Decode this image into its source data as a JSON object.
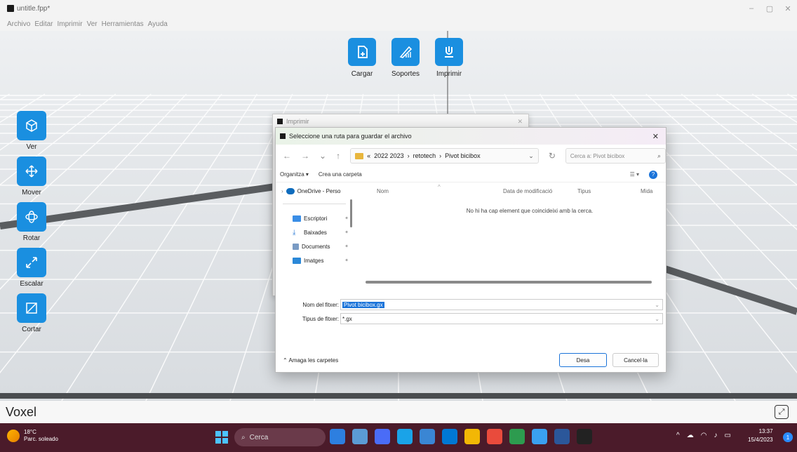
{
  "window": {
    "title": "untitle.fpp*",
    "controls": [
      "–",
      "▢",
      "✕"
    ]
  },
  "menu": [
    "Archivo",
    "Editar",
    "Imprimir",
    "Ver",
    "Herramientas",
    "Ayuda"
  ],
  "top_tools": [
    {
      "label": "Cargar",
      "icon": "load-icon"
    },
    {
      "label": "Soportes",
      "icon": "supports-icon"
    },
    {
      "label": "Imprimir",
      "icon": "print-icon"
    }
  ],
  "side_tools": [
    {
      "label": "Ver",
      "icon": "view-cube-icon"
    },
    {
      "label": "Mover",
      "icon": "move-icon"
    },
    {
      "label": "Rotar",
      "icon": "rotate-icon"
    },
    {
      "label": "Escalar",
      "icon": "scale-icon"
    },
    {
      "label": "Cortar",
      "icon": "cut-icon"
    }
  ],
  "bg_dialog": {
    "title": "Imprimir"
  },
  "save_dialog": {
    "title": "Seleccione una ruta para guardar el archivo",
    "breadcrumb": [
      "2022 2023",
      "retotech",
      "Pivot bicibox"
    ],
    "search_placeholder": "Cerca a: Pivot bicibox",
    "organize": "Organitza ▾",
    "new_folder": "Crea una carpeta",
    "nav": [
      {
        "label": "OneDrive - Perso",
        "color": "#0f6cbd"
      },
      {
        "label": "Escriptori",
        "color": "#3a8ee6"
      },
      {
        "label": "Baixades",
        "color": "#2a7ad5"
      },
      {
        "label": "Documents",
        "color": "#7a9bc4"
      },
      {
        "label": "Imatges",
        "color": "#2b88d8"
      }
    ],
    "columns": [
      "Nom",
      "Data de modificació",
      "Tipus",
      "Mida"
    ],
    "empty_message": "No hi ha cap element que coincideixi amb la cerca.",
    "file_name_label": "Nom del fitxer:",
    "file_name_value": "Pivot bicibox.gx",
    "file_type_label": "Tipus de fitxer:",
    "file_type_value": "*.gx",
    "hide_folders": "Amaga les carpetes",
    "save_button": "Desa",
    "cancel_button": "Cancel·la"
  },
  "status": {
    "mode": "Voxel"
  },
  "taskbar": {
    "temp": "18°C",
    "weather": "Parc. soleado",
    "search": "Cerca",
    "time": "13:37",
    "date": "15/4/2023",
    "notifications": "1",
    "apps": [
      "#2d7fe0",
      "#5b9bd5",
      "#4a6cf7",
      "#1aa3e8",
      "#3a86d4",
      "#0078d4",
      "#f2b705",
      "#e94b3c",
      "#2d9b4f",
      "#3aa0f0",
      "#2b579a",
      "#222222"
    ]
  }
}
